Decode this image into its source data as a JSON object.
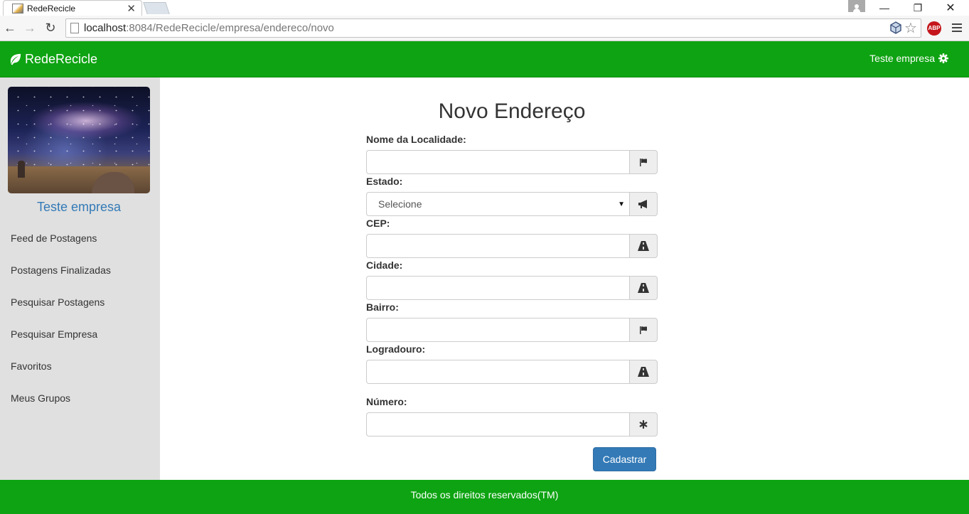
{
  "browser": {
    "tab_title": "RedeRecicle",
    "tab_close": "✕",
    "url_host": "localhost",
    "url_path": ":8084/RedeRecicle/empresa/endereco/novo",
    "abp_label": "ABP"
  },
  "navbar": {
    "brand": "RedeRecicle",
    "user": "Teste empresa"
  },
  "sidebar": {
    "company_name": "Teste empresa",
    "items": [
      {
        "label": "Feed de Postagens"
      },
      {
        "label": "Postagens Finalizadas"
      },
      {
        "label": "Pesquisar Postagens"
      },
      {
        "label": "Pesquisar Empresa"
      },
      {
        "label": "Favoritos"
      },
      {
        "label": "Meus Grupos"
      }
    ]
  },
  "form": {
    "title": "Novo Endereço",
    "fields": {
      "localidade": {
        "label": "Nome da Localidade:",
        "value": "",
        "icon": "flag-icon"
      },
      "estado": {
        "label": "Estado:",
        "selected": "Selecione",
        "icon": "bullhorn-icon"
      },
      "cep": {
        "label": "CEP:",
        "value": "",
        "icon": "road-icon"
      },
      "cidade": {
        "label": "Cidade:",
        "value": "",
        "icon": "road-icon"
      },
      "bairro": {
        "label": "Bairro:",
        "value": "",
        "icon": "flag-icon"
      },
      "logradouro": {
        "label": "Logradouro:",
        "value": "",
        "icon": "road-icon"
      },
      "numero": {
        "label": "Número:",
        "value": "",
        "icon": "asterisk-icon"
      }
    },
    "submit_label": "Cadastrar"
  },
  "footer": {
    "text": "Todos os direitos reservados(TM)"
  },
  "colors": {
    "brand_green": "#0ea312",
    "primary_blue": "#337ab7",
    "sidebar_bg": "#e0e0e0"
  }
}
